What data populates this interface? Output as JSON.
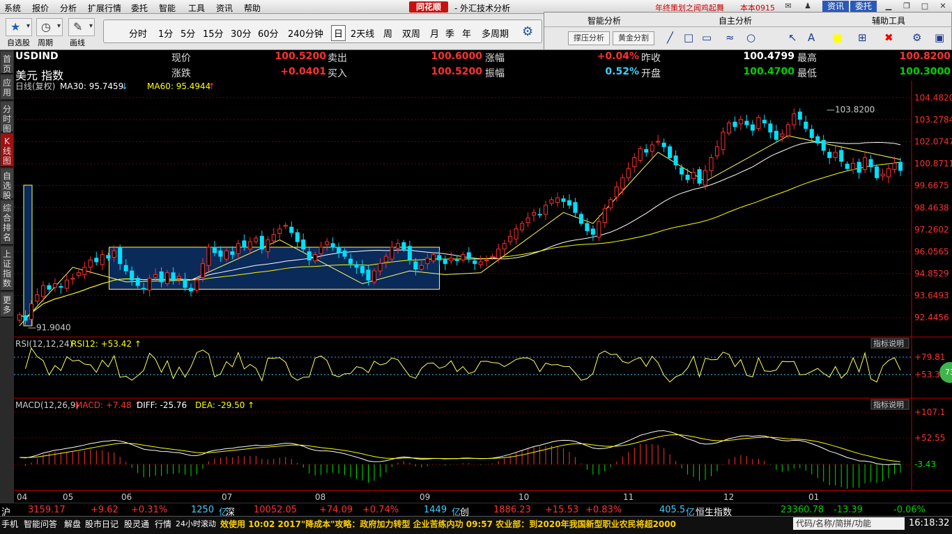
{
  "menu": [
    "系统",
    "报价",
    "分析",
    "扩展行情",
    "委托",
    "智能",
    "工具",
    "资讯",
    "帮助"
  ],
  "app": {
    "brand": "同花顺",
    "title": "- 外汇技术分析",
    "promo": "年终策划之闻鸡起舞",
    "version": "本本0915",
    "login": "资讯",
    "trade": "委托"
  },
  "toolbar": {
    "labels": [
      "自选股",
      "周期",
      "画线"
    ],
    "periods": [
      "分时",
      "1分",
      "5分",
      "15分",
      "30分",
      "60分",
      "240分钟",
      "日",
      "2天线",
      "周",
      "双周",
      "月",
      "季",
      "年",
      "多周期"
    ],
    "selected": "日"
  },
  "panel": {
    "heads": [
      "智能分析",
      "自主分析",
      "辅助工具"
    ],
    "buttons": [
      "撑压分析",
      "黄金分割"
    ]
  },
  "sidebar": [
    "首页",
    "应用",
    "分时图",
    "K线图",
    "自选股",
    "综合排名",
    "上证指数",
    "更多"
  ],
  "quote": {
    "code": "USDIND",
    "name": "美元 指数",
    "items": [
      {
        "l": "现价",
        "v": "100.5200",
        "c": "up"
      },
      {
        "l": "卖出",
        "v": "100.6000",
        "c": "up"
      },
      {
        "l": "涨幅",
        "v": "+0.04%",
        "c": "up"
      },
      {
        "l": "昨收",
        "v": "100.4799",
        "c": "wh"
      },
      {
        "l": "最高",
        "v": "100.8200",
        "c": "up"
      },
      {
        "l": "涨跌",
        "v": "+0.0401",
        "c": "up"
      },
      {
        "l": "买入",
        "v": "100.5200",
        "c": "up"
      },
      {
        "l": "振幅",
        "v": "0.52%",
        "c": "cy"
      },
      {
        "l": "开盘",
        "v": "100.4700",
        "c": "dn"
      },
      {
        "l": "最低",
        "v": "100.3000",
        "c": "dn"
      }
    ]
  },
  "chart_data": {
    "type": "candlestick",
    "header": "日线(复权)",
    "ma": [
      {
        "name": "MA30: 95.7459",
        "arrow": "↓",
        "color": "#ffffff"
      },
      {
        "name": "MA60: 95.4944",
        "arrow": "↑",
        "color": "#ffff00"
      }
    ],
    "yticks": [
      "104.4820",
      "103.2784",
      "102.0747",
      "100.8711",
      "99.6675",
      "98.4638",
      "97.2602",
      "96.0565",
      "94.8529",
      "93.6493",
      "92.4456"
    ],
    "ylim": [
      91.5,
      104.8
    ],
    "high_label": "103.8200",
    "low_label": "91.9040",
    "x_labels": [
      "04",
      "05",
      "06",
      "07",
      "08",
      "09",
      "10",
      "11",
      "12",
      "01"
    ],
    "closes": [
      92.6,
      92.3,
      93.2,
      93.7,
      94.2,
      94.0,
      94.3,
      94.1,
      94.5,
      94.6,
      94.9,
      95.2,
      95.6,
      95.5,
      95.9,
      95.7,
      96.1,
      95.4,
      95.0,
      94.5,
      94.2,
      94.0,
      94.6,
      94.8,
      94.4,
      94.9,
      94.5,
      94.7,
      94.1,
      93.9,
      94.5,
      95.4,
      96.3,
      96.0,
      95.8,
      96.1,
      95.9,
      96.5,
      96.3,
      96.6,
      96.8,
      96.2,
      96.7,
      97.0,
      97.3,
      97.5,
      97.1,
      96.6,
      96.2,
      95.6,
      95.9,
      96.3,
      96.6,
      96.3,
      96.0,
      95.8,
      95.4,
      95.2,
      94.9,
      94.5,
      95.0,
      95.4,
      95.8,
      96.3,
      96.5,
      96.2,
      95.6,
      95.1,
      95.3,
      95.7,
      95.9,
      95.6,
      95.4,
      95.7,
      95.6,
      95.9,
      95.7,
      95.4,
      95.5,
      95.6,
      95.8,
      96.2,
      96.5,
      96.9,
      97.3,
      97.6,
      97.9,
      98.2,
      98.1,
      98.6,
      98.9,
      99.0,
      98.8,
      98.6,
      98.2,
      97.6,
      97.2,
      97.0,
      97.7,
      98.4,
      98.9,
      99.6,
      100.1,
      100.6,
      101.2,
      101.7,
      101.5,
      101.9,
      102.1,
      101.8,
      101.2,
      100.8,
      100.3,
      100.0,
      100.4,
      99.8,
      100.5,
      101.2,
      101.8,
      102.6,
      103.1,
      102.9,
      103.3,
      103.0,
      102.7,
      103.4,
      103.1,
      102.6,
      102.2,
      102.5,
      103.0,
      103.6,
      103.3,
      102.8,
      102.3,
      102.0,
      101.6,
      101.2,
      101.5,
      101.0,
      100.6,
      100.9,
      100.4,
      101.2,
      100.7,
      100.1,
      100.3,
      100.6,
      100.9,
      100.5
    ],
    "boxes": [
      {
        "x0": 0.106,
        "x1": 0.474,
        "y0": 96.3,
        "y1": 94.0
      }
    ],
    "rsi": {
      "label": "RSI(12,12,24)",
      "value": "RSI12: +53.42",
      "arrow": "↑",
      "ticks": [
        "+79.81",
        "+53.30"
      ],
      "button": "指标说明"
    },
    "macd": {
      "label": "MACD(12,26,9)",
      "macd": "MACD: +7.48",
      "diff": "DIFF: -25.76",
      "dea": "DEA: -29.50",
      "ticks": [
        "+107.1",
        "+52.55",
        "-3.43"
      ],
      "button": "指标说明"
    }
  },
  "index_bar": [
    {
      "t": "沪",
      "c": "#fff"
    },
    {
      "t": "3159.17",
      "c": "#ff3030"
    },
    {
      "t": "+9.62",
      "c": "#ff3030"
    },
    {
      "t": "+0.31%",
      "c": "#ff3030"
    },
    {
      "t": "1250",
      "c": "#40d0ff"
    },
    {
      "t": "亿",
      "c": "#40d0ff"
    },
    {
      "t": "深",
      "c": "#fff"
    },
    {
      "t": "10052.05",
      "c": "#ff3030"
    },
    {
      "t": "+74.09",
      "c": "#ff3030"
    },
    {
      "t": "+0.74%",
      "c": "#ff3030"
    },
    {
      "t": "1449",
      "c": "#40d0ff"
    },
    {
      "t": "亿",
      "c": "#40d0ff"
    },
    {
      "t": "创",
      "c": "#fff"
    },
    {
      "t": "1886.23",
      "c": "#ff3030"
    },
    {
      "t": "+15.53",
      "c": "#ff3030"
    },
    {
      "t": "+0.83%",
      "c": "#ff3030"
    },
    {
      "t": "405.5",
      "c": "#40d0ff"
    },
    {
      "t": "亿",
      "c": "#40d0ff"
    },
    {
      "t": "恒生指数",
      "c": "#fff"
    },
    {
      "t": "23360.78",
      "c": "#00d000"
    },
    {
      "t": "-13.39",
      "c": "#00d000"
    },
    {
      "t": "-0.06%",
      "c": "#00d000"
    }
  ],
  "status": {
    "items": [
      "手机",
      "智能问答",
      "解盘",
      "股市日记",
      "股灵通",
      "行情",
      "24小时滚动"
    ],
    "ticker": "效使用        10:02 2017\"降成本\"攻略：政府加力转型 企业苦练内功              09:57 农业部：到2020年我国新型职业农民将超2000",
    "search": "代码/名称/简拼/功能",
    "clock": "16:18:32"
  },
  "badge": "73"
}
